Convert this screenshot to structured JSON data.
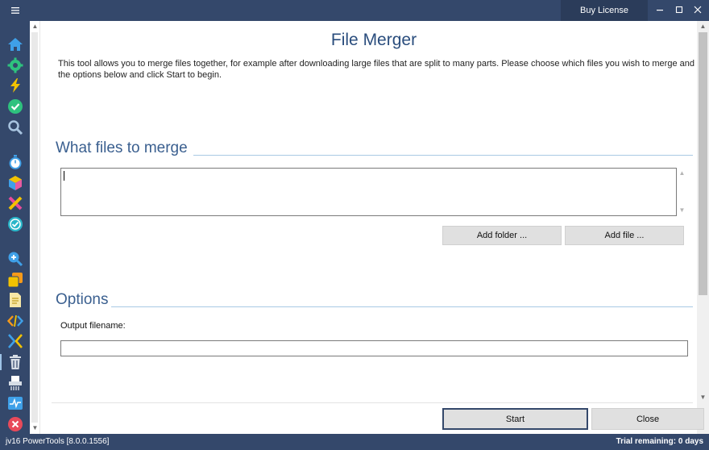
{
  "titlebar": {
    "buy_label": "Buy License",
    "menu_icon": "hamburger-icon",
    "min_icon": "minimize-icon",
    "max_icon": "maximize-icon",
    "close_icon": "close-icon"
  },
  "sidebar": {
    "items": [
      {
        "name": "home-icon",
        "color": "#3fa0e8"
      },
      {
        "name": "gear-icon",
        "color": "#2ec27e"
      },
      {
        "name": "lightning-icon",
        "color": "#f2c200"
      },
      {
        "name": "check-circle-icon",
        "color": "#2ec27e"
      },
      {
        "name": "search-icon",
        "color": "#a8c4e0"
      },
      {
        "name": "stopwatch-icon",
        "color": "#3fa0e8"
      },
      {
        "name": "cube-icon",
        "color": "#e85aa0"
      },
      {
        "name": "cross-icon",
        "color": "#e84a9a"
      },
      {
        "name": "refresh-check-icon",
        "color": "#29b6c9"
      },
      {
        "name": "zoom-in-icon",
        "color": "#3fa0e8"
      },
      {
        "name": "copy-icon",
        "color": "#f59a1a"
      },
      {
        "name": "document-icon",
        "color": "#f2c200"
      },
      {
        "name": "code-icon",
        "color": "#f59a1a"
      },
      {
        "name": "merge-icon",
        "color": "#3fa0e8"
      },
      {
        "name": "trash-icon",
        "color": "#d6dde6"
      },
      {
        "name": "shredder-icon",
        "color": "#d6dde6"
      },
      {
        "name": "activity-icon",
        "color": "#3fa0e8"
      },
      {
        "name": "uninstall-icon",
        "color": "#e84a5a"
      }
    ]
  },
  "main": {
    "title": "File Merger",
    "intro": "This tool allows you to merge files together, for example after downloading large files that are split to many parts. Please choose which files you wish to merge and the options below and click Start to begin.",
    "files_section": {
      "title": "What files to merge",
      "value": "",
      "add_folder_label": "Add folder ...",
      "add_file_label": "Add file ..."
    },
    "options_section": {
      "title": "Options",
      "output_label": "Output filename:",
      "output_value": ""
    }
  },
  "footer": {
    "start_label": "Start",
    "close_label": "Close"
  },
  "status": {
    "version": "jv16 PowerTools [8.0.0.1556]",
    "trial": "Trial remaining: 0 days"
  },
  "colors": {
    "frame": "#34486b",
    "title": "#2a4d7d",
    "section": "#3a5f8f",
    "section_line": "#a9c9e4",
    "button": "#e0e0e0"
  }
}
